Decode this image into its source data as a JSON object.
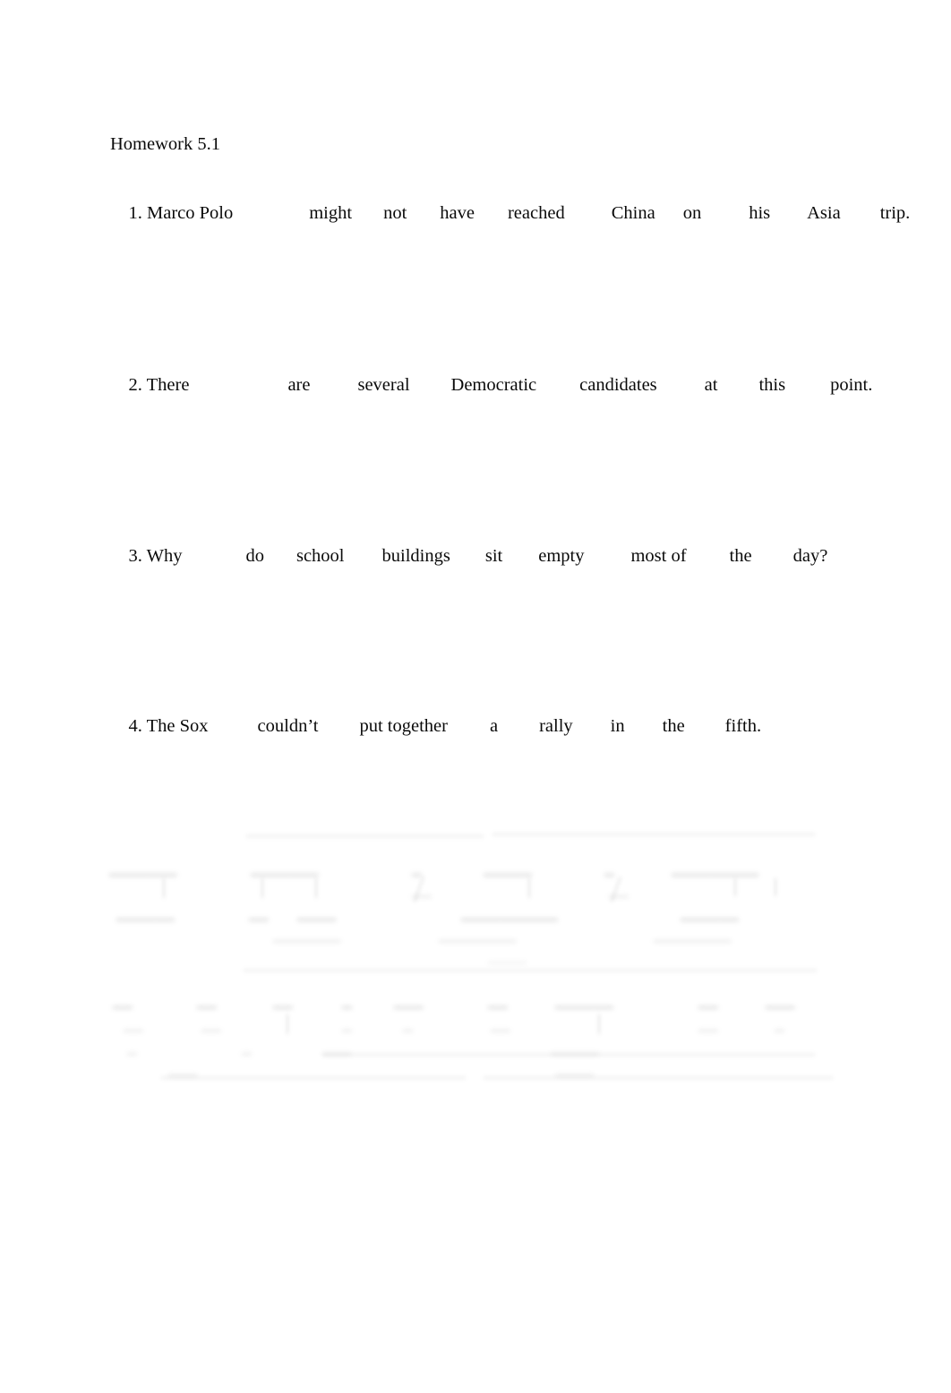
{
  "document": {
    "title": "Homework 5.1",
    "background_color": "#ffffff",
    "text_color": "#0a0a0a"
  },
  "exercises": [
    {
      "number": "1.",
      "words": [
        "1. Marco Polo",
        "might",
        "not",
        "have",
        "reached",
        "China",
        "on",
        "his",
        "Asia",
        "trip."
      ],
      "sentence": "1. Marco Polo might not have reached China on his Asia trip."
    },
    {
      "number": "2.",
      "words": [
        "2. There",
        "are",
        "several",
        "Democratic",
        "candidates",
        "at",
        "this",
        "point."
      ],
      "sentence": "2. There are several Democratic candidates at this point."
    },
    {
      "number": "3.",
      "words": [
        "3. Why",
        "do",
        "school",
        "buildings",
        "sit",
        "empty",
        "most of",
        "the",
        "day?"
      ],
      "sentence": "3. Why do school buildings sit empty most of the day?"
    },
    {
      "number": "4.",
      "words": [
        "4. The Sox",
        "couldn’t",
        "put together",
        "a",
        "rally",
        "in",
        "the",
        "fifth."
      ],
      "sentence": "4. The Sox couldn’t put together a rally in the fifth."
    }
  ],
  "line_1": {
    "w0": "1. Marco Polo",
    "w1": "might",
    "w2": "not",
    "w3": "have",
    "w4": "reached",
    "w5": "China",
    "w6": "on",
    "w7": "his",
    "w8": "Asia",
    "w9": "trip."
  },
  "line_2": {
    "w0": "2. There",
    "w1": "are",
    "w2": "several",
    "w3": "Democratic",
    "w4": "candidates",
    "w5": "at",
    "w6": "this",
    "w7": "point."
  },
  "line_3": {
    "w0": "3. Why",
    "w1": "do",
    "w2": "school",
    "w3": "buildings",
    "w4": "sit",
    "w5": "empty",
    "w6": "most of",
    "w7": "the",
    "w8": "day?"
  },
  "line_4": {
    "w0": "4. The Sox",
    "w1": "couldn’t",
    "w2": "put together",
    "w3": "a",
    "w4": "rally",
    "w5": "in",
    "w6": "the",
    "w7": "fifth."
  },
  "faded_section": {
    "description": "illegible faded sentence-diagram artifact",
    "legible": false,
    "placeholder": ""
  }
}
